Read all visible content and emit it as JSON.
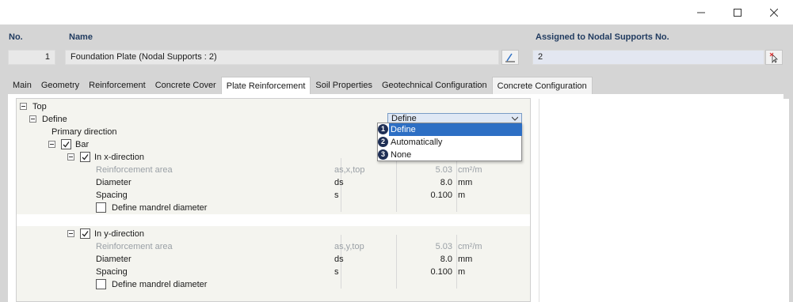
{
  "header": {
    "no_label": "No.",
    "no_value": "1",
    "name_label": "Name",
    "name_value": "Foundation Plate (Nodal Supports : 2)",
    "assigned_label": "Assigned to Nodal Supports No.",
    "assigned_value": "2"
  },
  "tabs": [
    {
      "label": "Main"
    },
    {
      "label": "Geometry"
    },
    {
      "label": "Reinforcement"
    },
    {
      "label": "Concrete Cover"
    },
    {
      "label": "Plate Reinforcement",
      "active": true
    },
    {
      "label": "Soil Properties"
    },
    {
      "label": "Geotechnical Configuration"
    },
    {
      "label": "Concrete Configuration"
    }
  ],
  "tree": {
    "top": "Top",
    "define": "Define",
    "primary_direction": "Primary direction",
    "bar": "Bar",
    "x_dir": {
      "label": "In x-direction",
      "reinf_area": {
        "label": "Reinforcement area",
        "sym": "as,x,top",
        "value": "5.03",
        "unit": "cm²/m"
      },
      "diameter": {
        "label": "Diameter",
        "sym": "ds",
        "value": "8.0",
        "unit": "mm"
      },
      "spacing": {
        "label": "Spacing",
        "sym": "s",
        "value": "0.100",
        "unit": "m"
      },
      "mandrel": "Define mandrel diameter"
    },
    "y_dir": {
      "label": "In y-direction",
      "reinf_area": {
        "label": "Reinforcement area",
        "sym": "as,y,top",
        "value": "5.03",
        "unit": "cm²/m"
      },
      "diameter": {
        "label": "Diameter",
        "sym": "ds",
        "value": "8.0",
        "unit": "mm"
      },
      "spacing": {
        "label": "Spacing",
        "sym": "s",
        "value": "0.100",
        "unit": "m"
      },
      "mandrel": "Define mandrel diameter"
    }
  },
  "define_select": {
    "value": "Define",
    "options": [
      "Define",
      "Automatically",
      "None"
    ],
    "badges": [
      "1",
      "2",
      "3"
    ]
  },
  "colors": {
    "accent": "#2d6fc4",
    "label_blue": "#1f3a5f",
    "badge": "#1f2f55"
  }
}
